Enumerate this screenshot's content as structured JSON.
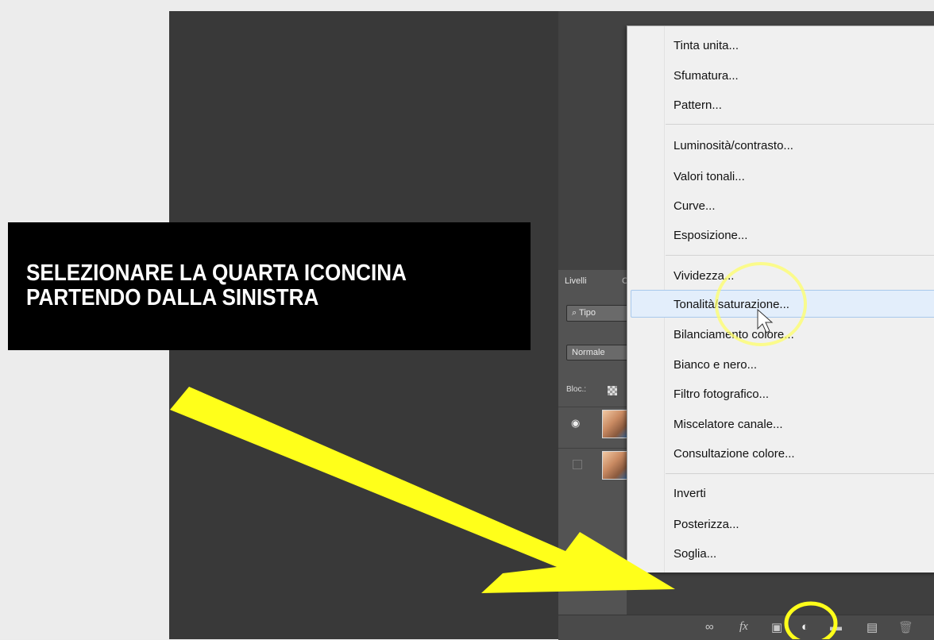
{
  "annotation": {
    "line1": "SELEZIONARE LA QUARTA ICONCINA",
    "line2": "PARTENDO DALLA SINISTRA",
    "arrow_color": "#ffff1a",
    "circle_color": "#ffff1a"
  },
  "layers_panel": {
    "tab_active": "Livelli",
    "tab_next": "C",
    "filter_label": "Tipo",
    "blend_mode": "Normale",
    "lock_label": "Bloc.:"
  },
  "menu": {
    "items": [
      "Tinta unita...",
      "Sfumatura...",
      "Pattern...",
      "Luminosità/contrasto...",
      "Valori tonali...",
      "Curve...",
      "Esposizione...",
      "Vividezza...",
      "Tonalità/saturazione...",
      "Bilanciamento colore...",
      "Bianco e nero...",
      "Filtro fotografico...",
      "Miscelatore canale...",
      "Consultazione colore...",
      "Inverti",
      "Posterizza...",
      "Soglia..."
    ],
    "highlighted": "Tonalità/saturazione..."
  },
  "bottom_bar": {
    "icons": [
      "link-icon",
      "fx-icon",
      "mask-icon",
      "adjustment-layer-icon",
      "folder-icon",
      "new-layer-icon",
      "trash-icon"
    ],
    "fx_label": "fx"
  }
}
